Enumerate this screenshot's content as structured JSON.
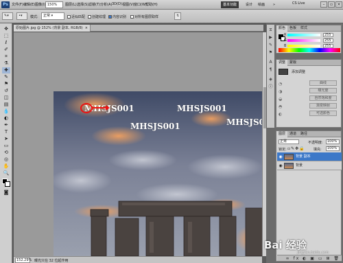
{
  "app": {
    "logo": "Ps"
  },
  "menu": {
    "items": [
      "文件(F)",
      "编辑(E)",
      "图像(I)",
      "图层(L)",
      "选择(S)",
      "滤镜(T)",
      "分析(A)",
      "3D(D)",
      "视图(V)",
      "窗口(W)",
      "帮助(H)"
    ]
  },
  "titlebar": {
    "zoom": "150%",
    "workspaces": {
      "active": "基本功能",
      "design": "设计",
      "painting": "绘画",
      "more": "»"
    },
    "cs_live": "CS Live"
  },
  "options": {
    "mode_label": "模式:",
    "mode_value": "正常",
    "opacity_label": "不透明度:",
    "opacity_value": "100%",
    "checks": [
      "近似匹配",
      "创建纹理",
      "内容识别"
    ],
    "sample_all": "对所有图层取样"
  },
  "document": {
    "tab_title": "原始图片.jpg @ 152% (背景 副本, RGB/8)",
    "close": "×",
    "watermarks": [
      "MHSJS001",
      "MHSJS001",
      "MHSJS001",
      "MHSJS001"
    ],
    "status_zoom": "152.29%",
    "status_info": "曝光只在 32 位起作用"
  },
  "color_panel": {
    "tabs": [
      "颜色",
      "色板",
      "样式"
    ],
    "channels": [
      {
        "label": "R",
        "value": "255"
      },
      {
        "label": "G",
        "value": "255"
      },
      {
        "label": "B",
        "value": "255"
      }
    ]
  },
  "adjust_panel": {
    "tabs": [
      "调整",
      "蒙版"
    ],
    "hint": "添加调整",
    "items": [
      "曲线",
      "曝光度",
      "自然饱和度",
      "渐变映射",
      "可选颜色"
    ]
  },
  "layers_panel": {
    "tabs": [
      "图层",
      "通道",
      "路径"
    ],
    "blend_mode": "正常",
    "opacity_label": "不透明度:",
    "opacity_value": "100%",
    "lock_label": "锁定:",
    "fill_label": "填充:",
    "fill_value": "100%",
    "layers": [
      {
        "name": "背景 副本",
        "selected": true
      },
      {
        "name": "背景",
        "selected": false
      }
    ],
    "footer": "∞ fx ◐ ▣ ▭ ⊞ 🗑"
  },
  "watermark_overlay": {
    "brand": "Bai 经验",
    "url": "jingyan.baidu.com"
  },
  "colors": {
    "accent": "#3c78c8",
    "annotation": "#e11111"
  }
}
